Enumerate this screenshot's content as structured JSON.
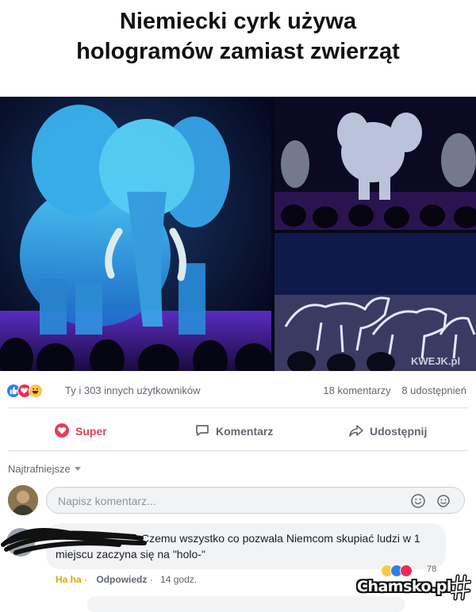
{
  "meme": {
    "title_line1": "Niemiecki cyrk używa",
    "title_line2": "hologramów zamiast zwierząt",
    "photo_watermark": "KWEJK.pl"
  },
  "post": {
    "reaction_icons": [
      "like-icon",
      "love-icon",
      "haha-icon"
    ],
    "reaction_summary": "Ty i 303 innych użytkowników",
    "comments_count": "18 komentarzy",
    "shares_count": "8 udostępnień",
    "actions": {
      "super_label": "Super",
      "comment_label": "Komentarz",
      "share_label": "Udostępnij"
    },
    "accent_colors": {
      "love": "#e33e57",
      "like": "#2d7ff0",
      "haha": "#f7c94a"
    }
  },
  "comments_section": {
    "sort_label": "Najtrafniejsze",
    "input_placeholder": "Napisz komentarz...",
    "comment": {
      "text": "Czemu wszystko co pozwala Niemcom skupiać ludzi w 1 miejscu zaczyna się na \"holo-\"",
      "haha_label": "Ha ha",
      "reply_label": "Odpowiedz",
      "time": "14 godz.",
      "reaction_count": "78"
    }
  },
  "watermark": {
    "text": "Chamsko.pl"
  }
}
